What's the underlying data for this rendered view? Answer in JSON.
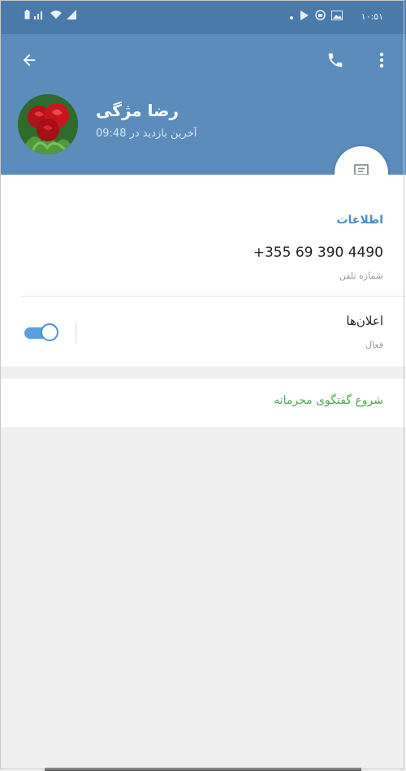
{
  "status_bar": {
    "time": "۱۰:۵۱",
    "left_icons": [
      "battery-icon",
      "signal-bars-icon",
      "wifi-icon",
      "signal-icon"
    ],
    "right_icons": [
      "dot-icon",
      "play-store-icon",
      "vpn-icon",
      "image-icon"
    ]
  },
  "header": {
    "back_icon": "arrow-left-icon",
    "call_icon": "phone-icon",
    "menu_icon": "more-vertical-icon",
    "contact_name": "رضا مژگی",
    "last_seen": "آخرین بازدید در 09:48",
    "fab_icon": "message-icon"
  },
  "info": {
    "section_title": "اطلاعات",
    "phone_number": "+355 69 390 4490",
    "phone_label": "شماره تلفن",
    "notifications_title": "اعلان‌ها",
    "notifications_status": "فعال",
    "notifications_enabled": true
  },
  "secret_chat": {
    "label": "شروع گفتگوی محرمانه"
  },
  "colors": {
    "header": "#5b8cbc",
    "status_bar": "#4a7aa9",
    "accent_blue": "#4b8ac6",
    "accent_green": "#4ea852",
    "background": "#efefef"
  }
}
